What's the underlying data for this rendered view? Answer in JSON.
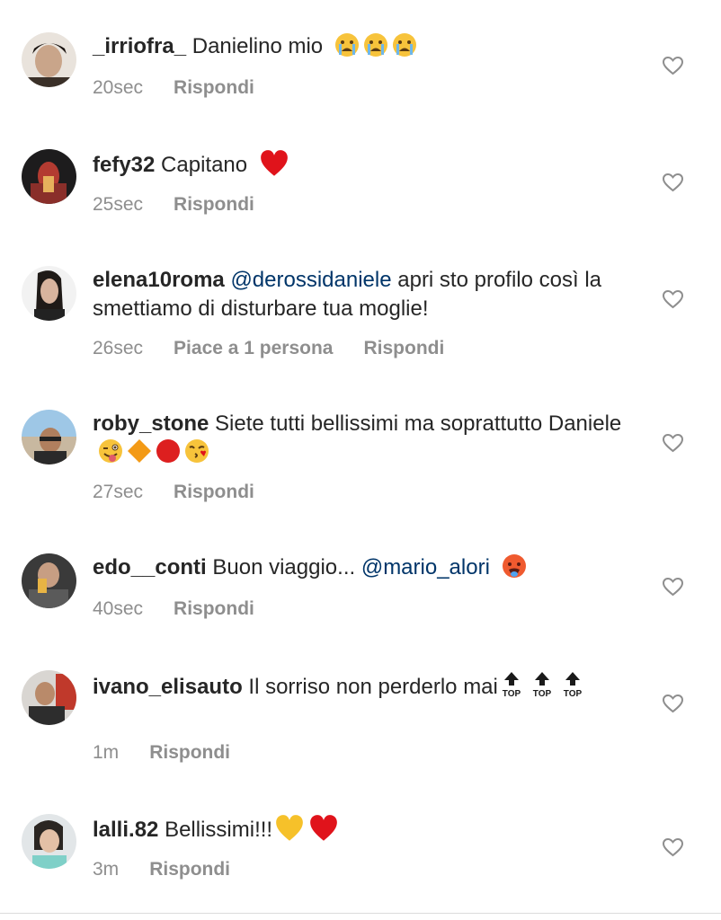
{
  "comments": [
    {
      "user": "_irriofra_",
      "text": "Danielino mio",
      "time": "20sec",
      "likes": "",
      "reply": "Rispondi",
      "emoji": [
        "crying-face",
        "crying-face",
        "crying-face"
      ]
    },
    {
      "user": "fefy32",
      "text": "Capitano",
      "time": "25sec",
      "likes": "",
      "reply": "Rispondi",
      "emoji": [
        "red-heart"
      ]
    },
    {
      "user": "elena10roma",
      "mention": "@derossidaniele",
      "text": " apri sto profilo così la smettiamo di disturbare tua moglie!",
      "time": "26sec",
      "likes": "Piace a 1 persona",
      "reply": "Rispondi"
    },
    {
      "user": "roby_stone",
      "text": "Siete tutti bellissimi ma soprattutto Daniele",
      "time": "27sec",
      "likes": "",
      "reply": "Rispondi",
      "emoji": [
        "winking-tongue-face",
        "orange-diamond",
        "red-circle",
        "kissing-heart-face"
      ]
    },
    {
      "user": "edo__conti",
      "text": "Buon viaggio... ",
      "mention": "@mario_alori",
      "time": "40sec",
      "likes": "",
      "reply": "Rispondi",
      "emoji": [
        "hot-face"
      ]
    },
    {
      "user": "ivano_elisauto",
      "text": "Il sorriso non perderlo mai",
      "time": "1m",
      "likes": "",
      "reply": "Rispondi",
      "emoji": [
        "top-arrow",
        "top-arrow",
        "top-arrow"
      ],
      "top_label": "TOP"
    },
    {
      "user": "lalli.82",
      "text": "Bellissimi!!!",
      "time": "3m",
      "likes": "",
      "reply": "Rispondi",
      "emoji": [
        "yellow-heart",
        "red-heart"
      ]
    }
  ],
  "colors": {
    "text": "#262626",
    "meta": "#8e8e8e",
    "mention": "#003569",
    "heart_outline": "#8e8e8e"
  }
}
